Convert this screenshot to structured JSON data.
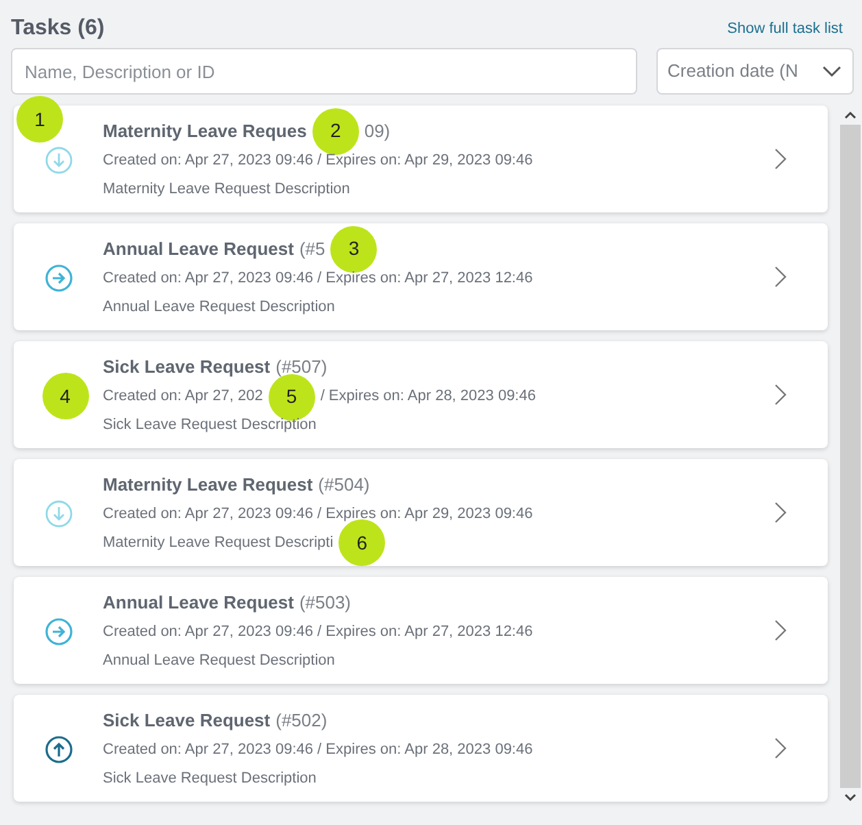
{
  "header": {
    "title": "Tasks (6)",
    "link": "Show full task list"
  },
  "search": {
    "placeholder": "Name, Description or ID"
  },
  "sort": {
    "value": "Creation date (N"
  },
  "tasks": [
    {
      "corner_marker": "1",
      "icon": {
        "kind": "down"
      },
      "heading": [
        {
          "kind": "title",
          "text": "Maternity Leave Reques"
        },
        {
          "kind": "marker",
          "text": "2"
        },
        {
          "kind": "id",
          "text": "09)"
        }
      ],
      "meta": [
        {
          "kind": "text",
          "text": "Created on: Apr 27, 2023 09:46 / Expires on: Apr 29, 2023 09:46"
        }
      ],
      "description": [
        {
          "kind": "text",
          "text": "Maternity Leave Request Description"
        }
      ]
    },
    {
      "icon": {
        "kind": "right"
      },
      "heading": [
        {
          "kind": "title",
          "text": "Annual Leave Request"
        },
        {
          "kind": "id",
          "text": "(#5"
        },
        {
          "kind": "marker",
          "text": "3"
        }
      ],
      "meta": [
        {
          "kind": "text",
          "text": "Created on: Apr 27, 2023 09:46 / Expires on: Apr 27, 2023 12:46"
        }
      ],
      "description": [
        {
          "kind": "text",
          "text": "Annual Leave Request Description"
        }
      ]
    },
    {
      "icon": {
        "kind": "marker",
        "text": "4"
      },
      "heading": [
        {
          "kind": "title",
          "text": "Sick Leave Request"
        },
        {
          "kind": "id",
          "text": "(#507)"
        }
      ],
      "meta": [
        {
          "kind": "text",
          "text": "Created on: Apr 27, 202"
        },
        {
          "kind": "marker",
          "text": "5"
        },
        {
          "kind": "text",
          "text": "/ Expires on: Apr 28, 2023 09:46"
        }
      ],
      "description": [
        {
          "kind": "text",
          "text": "Sick Leave Request Description"
        }
      ]
    },
    {
      "icon": {
        "kind": "down"
      },
      "heading": [
        {
          "kind": "title",
          "text": "Maternity Leave Request"
        },
        {
          "kind": "id",
          "text": "(#504)"
        }
      ],
      "meta": [
        {
          "kind": "text",
          "text": "Created on: Apr 27, 2023 09:46 / Expires on: Apr 29, 2023 09:46"
        }
      ],
      "description": [
        {
          "kind": "text",
          "text": "Maternity Leave Request Descripti"
        },
        {
          "kind": "marker",
          "text": "6"
        }
      ]
    },
    {
      "icon": {
        "kind": "right"
      },
      "heading": [
        {
          "kind": "title",
          "text": "Annual Leave Request"
        },
        {
          "kind": "id",
          "text": "(#503)"
        }
      ],
      "meta": [
        {
          "kind": "text",
          "text": "Created on: Apr 27, 2023 09:46 / Expires on: Apr 27, 2023 12:46"
        }
      ],
      "description": [
        {
          "kind": "text",
          "text": "Annual Leave Request Description"
        }
      ]
    },
    {
      "icon": {
        "kind": "up"
      },
      "heading": [
        {
          "kind": "title",
          "text": "Sick Leave Request"
        },
        {
          "kind": "id",
          "text": "(#502)"
        }
      ],
      "meta": [
        {
          "kind": "text",
          "text": "Created on: Apr 27, 2023 09:46 / Expires on: Apr 28, 2023 09:46"
        }
      ],
      "description": [
        {
          "kind": "text",
          "text": "Sick Leave Request Description"
        }
      ]
    }
  ]
}
